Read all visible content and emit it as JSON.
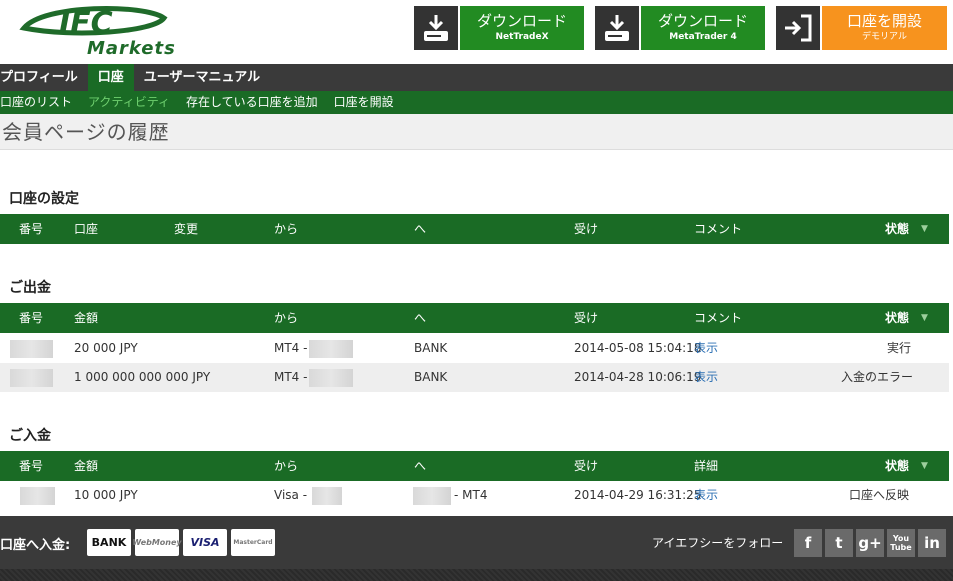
{
  "header": {
    "logo_text": "Markets",
    "logo_mark": "IFC",
    "downloads": [
      {
        "line1": "ダウンロード",
        "line2": "NetTradeX",
        "icon": "download-icon"
      },
      {
        "line1": "ダウンロード",
        "line2": "MetaTrader 4",
        "icon": "download-icon"
      },
      {
        "line1": "口座を開設",
        "line2": "デモリアル",
        "icon": "signin-icon"
      }
    ]
  },
  "nav": {
    "items": [
      "プロフィール",
      "口座",
      "ユーザーマニュアル"
    ],
    "active": "口座"
  },
  "subnav": {
    "items": [
      "口座のリスト",
      "アクティビティ",
      "存在している口座を追加",
      "口座を開設"
    ],
    "active": "アクティビティ"
  },
  "page_title": "会員ページの履歴",
  "settings": {
    "title": "口座の設定",
    "columns": [
      "番号",
      "口座",
      "変更",
      "から",
      "へ",
      "受け",
      "コメント",
      "状態"
    ]
  },
  "withdrawals": {
    "title": "ご出金",
    "columns": [
      "番号",
      "金額",
      "から",
      "へ",
      "受け",
      "コメント",
      "状態"
    ],
    "rows": [
      {
        "amount": "20 000 JPY",
        "from": "MT4 -",
        "to": "BANK",
        "received": "2014-05-08 15:04:18",
        "comment": "表示",
        "status": "実行"
      },
      {
        "amount": "1 000 000 000 000 JPY",
        "from": "MT4 -",
        "to": "BANK",
        "received": "2014-04-28 10:06:19",
        "comment": "表示",
        "status": "入金のエラー"
      }
    ]
  },
  "deposits": {
    "title": "ご入金",
    "columns": [
      "番号",
      "金額",
      "から",
      "へ",
      "受け",
      "詳細",
      "状態"
    ],
    "rows": [
      {
        "amount": "10 000 JPY",
        "from": "Visa -",
        "to": "- MT4",
        "received": "2014-04-29 16:31:25",
        "detail": "表示",
        "status": "口座へ反映"
      }
    ]
  },
  "footer": {
    "deposit_label": "口座へ入金:",
    "payments": [
      "BANK",
      "WebMoney",
      "VISA",
      "MasterCard"
    ],
    "follow_label": "アイエフシーをフォロー",
    "social": [
      "f",
      "t",
      "g+",
      "You Tube",
      "in"
    ]
  },
  "colors": {
    "green": "#1a6b25",
    "button_green": "#228b22",
    "orange": "#f7931e",
    "dark": "#3a3a3a",
    "link": "#2b6fb3"
  }
}
